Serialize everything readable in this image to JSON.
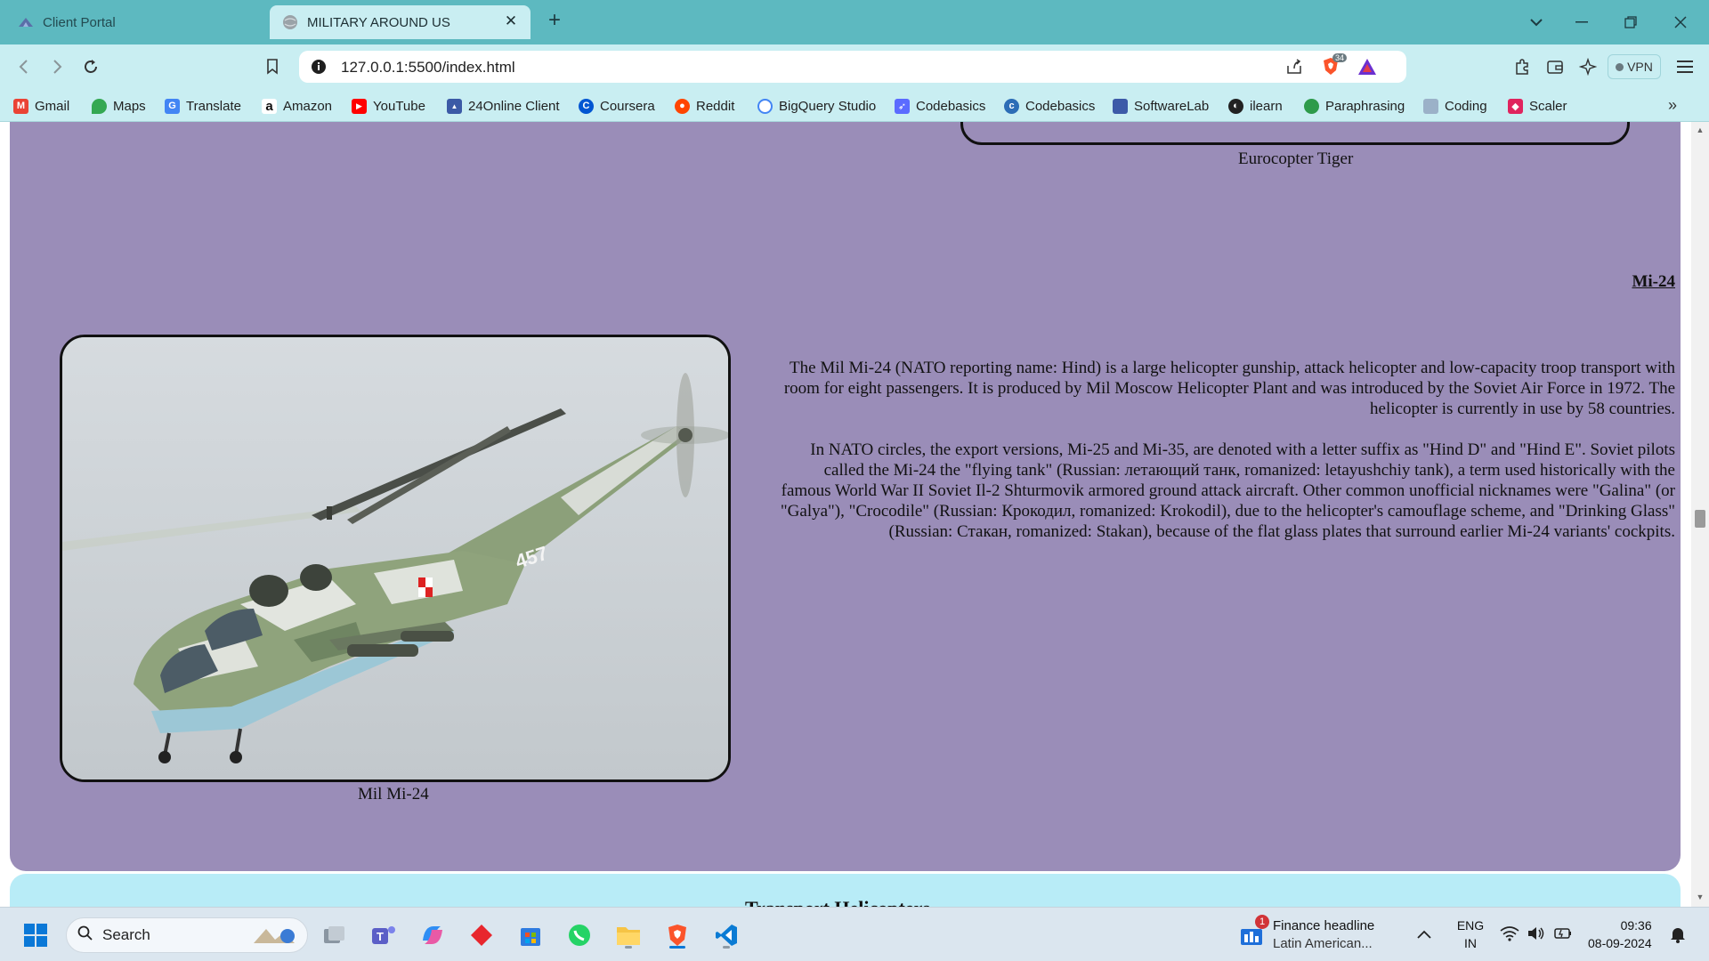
{
  "browser": {
    "tabs": [
      {
        "title": "Client Portal",
        "active": false
      },
      {
        "title": "MILITARY AROUND US",
        "active": true
      }
    ],
    "url": {
      "host": "127.0.0.1",
      "rest": ":5500/index.html"
    },
    "shield_count": "34",
    "vpn_label": "VPN",
    "bookmarks": [
      {
        "label": "Gmail",
        "icon": "gmail-icon",
        "color": "#ea4335"
      },
      {
        "label": "Maps",
        "icon": "maps-icon",
        "color": "#34a853"
      },
      {
        "label": "Translate",
        "icon": "translate-icon",
        "color": "#4285f4"
      },
      {
        "label": "Amazon",
        "icon": "amazon-icon",
        "color": "#111111"
      },
      {
        "label": "YouTube",
        "icon": "youtube-icon",
        "color": "#ff0000"
      },
      {
        "label": "24Online Client",
        "icon": "24online-icon",
        "color": "#3b5aa6"
      },
      {
        "label": "Coursera",
        "icon": "coursera-icon",
        "color": "#0056d2"
      },
      {
        "label": "Reddit",
        "icon": "reddit-icon",
        "color": "#ff4500"
      },
      {
        "label": "BigQuery Studio",
        "icon": "bigquery-icon",
        "color": "#4285f4"
      },
      {
        "label": "Codebasics",
        "icon": "rocket-icon",
        "color": "#5b6bff"
      },
      {
        "label": "Codebasics",
        "icon": "codebasics-icon",
        "color": "#2c6db6"
      },
      {
        "label": "SoftwareLab",
        "icon": "softwarelab-icon",
        "color": "#3c5aa8"
      },
      {
        "label": "ilearn",
        "icon": "ilearn-icon",
        "color": "#222222"
      },
      {
        "label": "Paraphrasing",
        "icon": "paraphrasing-icon",
        "color": "#2e9b4b"
      },
      {
        "label": "Coding",
        "icon": "coding-icon",
        "color": "#9bb1c8"
      },
      {
        "label": "Scaler",
        "icon": "scaler-icon",
        "color": "#e0245e"
      }
    ]
  },
  "page": {
    "prev_caption": "Eurocopter Tiger",
    "heading": "Mi-24",
    "image_caption": "Mil Mi-24",
    "paragraph1": "The Mil Mi-24 (NATO reporting name: Hind) is a large helicopter gunship, attack helicopter and low-capacity troop transport with room for eight passengers. It is produced by Mil Moscow Helicopter Plant and was introduced by the Soviet Air Force in 1972. The helicopter is currently in use by 58 countries.",
    "paragraph2": "In NATO circles, the export versions, Mi-25 and Mi-35, are denoted with a letter suffix as \"Hind D\" and \"Hind E\". Soviet pilots called the Mi-24 the \"flying tank\" (Russian: летающий танк, romanized: letayushchiy tank), a term used historically with the famous World War II Soviet Il-2 Shturmovik armored ground attack aircraft. Other common unofficial nicknames were \"Galina\" (or \"Galya\"), \"Crocodile\" (Russian: Крокодил, romanized: Krokodil), due to the helicopter's camouflage scheme, and \"Drinking Glass\" (Russian: Стакан, romanized: Stakan), because of the flat glass plates that surround earlier Mi-24 variants' cockpits.",
    "tail_number": "457",
    "next_section_title": "Transport Helicopters"
  },
  "taskbar": {
    "search_label": "Search",
    "news_badge": "1",
    "news_title": "Finance headline",
    "news_sub": "Latin American...",
    "lang_line1": "ENG",
    "lang_line2": "IN",
    "time": "09:36",
    "date": "08-09-2024"
  }
}
